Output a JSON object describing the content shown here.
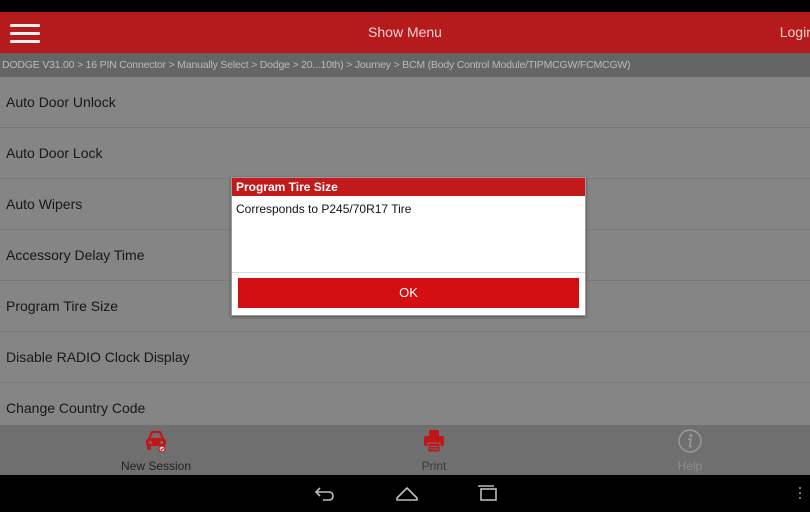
{
  "header": {
    "title": "Show Menu",
    "login_label": "Login"
  },
  "breadcrumb": "DODGE V31.00 > 16 PIN Connector > Manually Select > Dodge > 20...10th) > Journey > BCM (Body Control Module/TIPMCGW/FCMCGW)",
  "menu_items": [
    {
      "label": "Auto Door Unlock"
    },
    {
      "label": "Auto Door Lock"
    },
    {
      "label": "Auto Wipers"
    },
    {
      "label": "Accessory Delay Time"
    },
    {
      "label": "Program Tire Size"
    },
    {
      "label": "Disable RADIO Clock Display"
    },
    {
      "label": "Change Country Code"
    }
  ],
  "dialog": {
    "title": "Program Tire Size",
    "message": "Corresponds to P245/70R17 Tire",
    "ok_label": "OK"
  },
  "bottom_bar": {
    "new_session_label": "New Session",
    "print_label": "Print",
    "help_label": "Help"
  },
  "icons": {
    "menu": "hamburger-menu-icon",
    "new_session": "car-icon",
    "print": "printer-icon",
    "help": "info-icon",
    "back": "back-arrow-icon",
    "home": "home-icon",
    "recent": "recent-apps-icon"
  },
  "colors": {
    "header_red": "#b51b1c",
    "dialog_title_red": "#c2191b",
    "ok_button_red": "#d40f11",
    "icon_red": "#c0161a",
    "list_bg": "#b9b9b9",
    "breadcrumb_bg": "#8c8c8c",
    "bottom_bar_bg": "#6f6f6f"
  }
}
